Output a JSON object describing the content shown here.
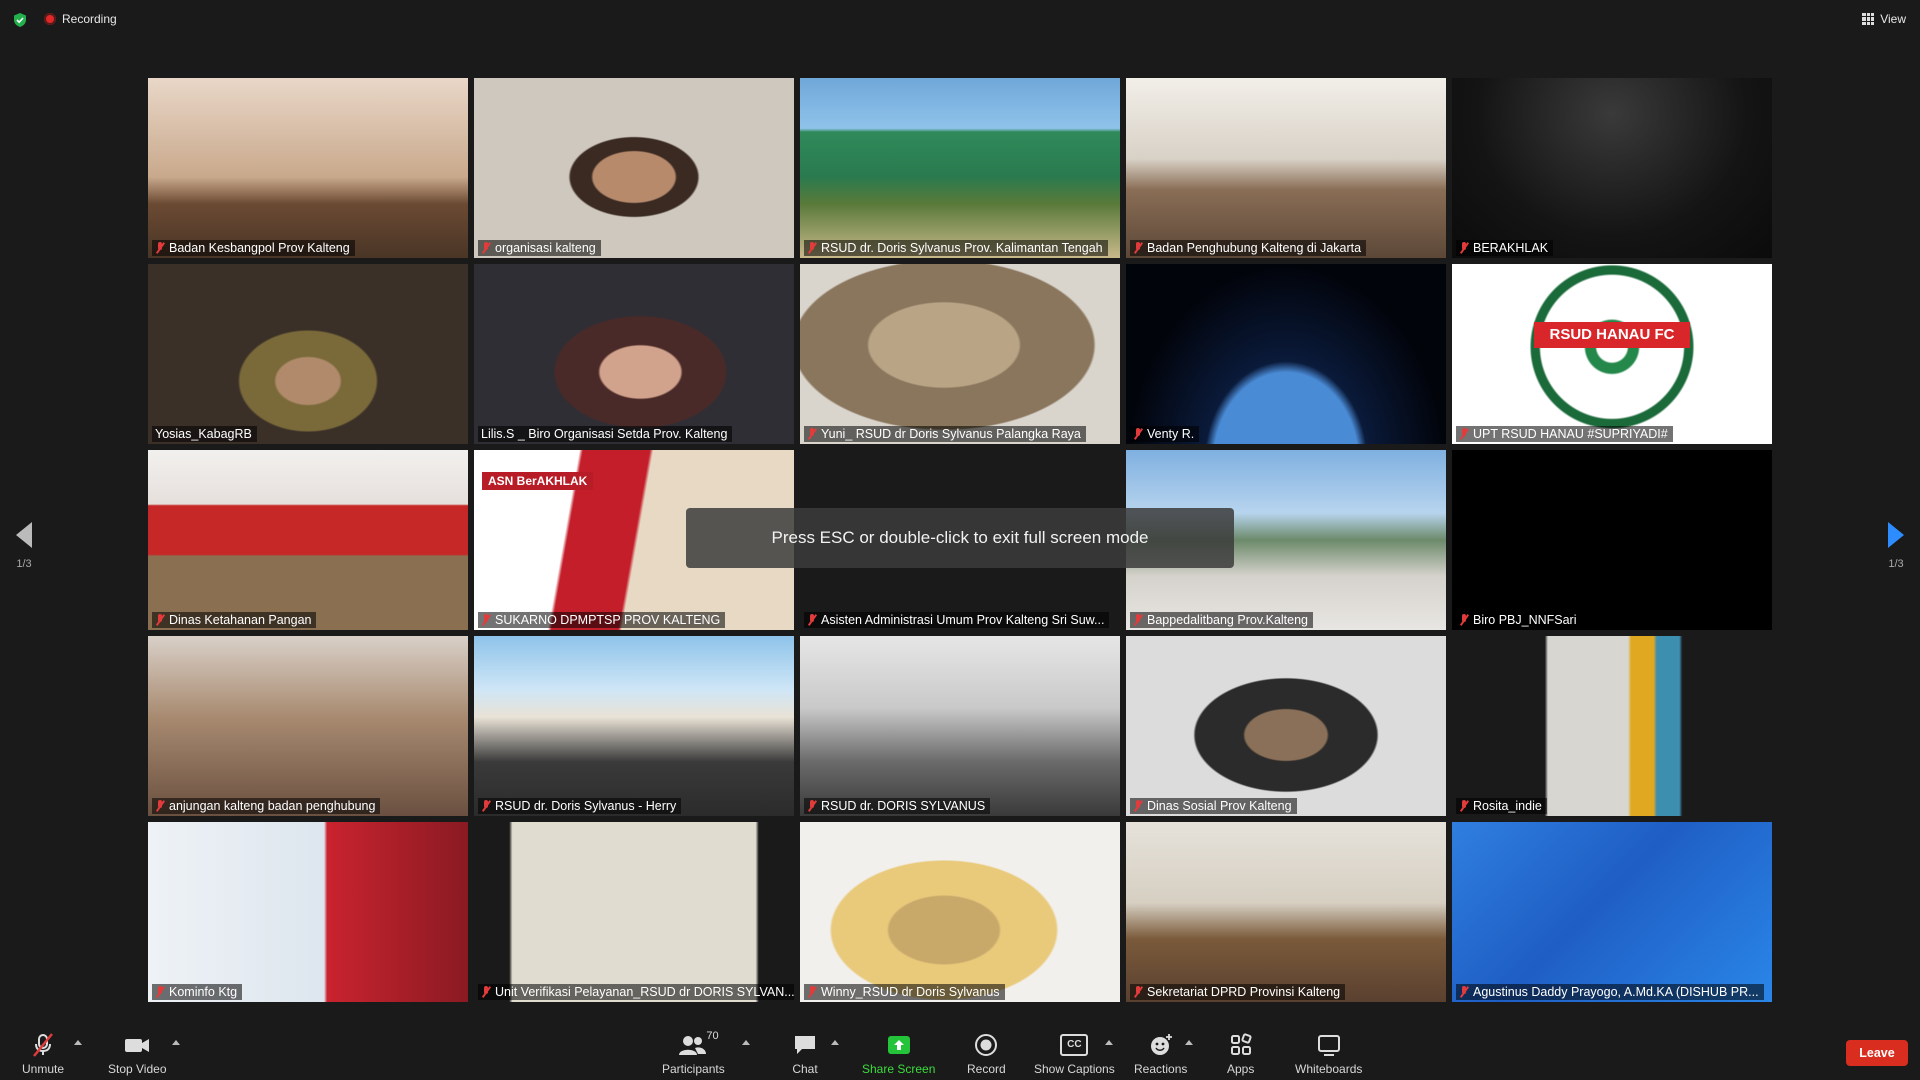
{
  "topbar": {
    "recording_label": "Recording",
    "view_label": "View"
  },
  "pager": {
    "left": "1/3",
    "right": "1/3"
  },
  "toast": "Press ESC or double-click to exit full screen mode",
  "tiles": [
    {
      "name": "Badan Kesbangpol Prov Kalteng",
      "muted": true,
      "scene": "meeting-room-curtain"
    },
    {
      "name": "organisasi kalteng",
      "muted": true,
      "scene": "person-closeup"
    },
    {
      "name": "RSUD dr. Doris Sylvanus Prov. Kalimantan Tengah",
      "muted": true,
      "scene": "hospital-sign"
    },
    {
      "name": "Badan Penghubung Kalteng di Jakarta",
      "muted": true,
      "scene": "official-room"
    },
    {
      "name": "BERAKHLAK",
      "muted": true,
      "scene": "dark"
    },
    {
      "name": "Yosias_KabagRB",
      "muted": false,
      "scene": "office-speaker",
      "active": true
    },
    {
      "name": "Lilis.S _ Biro Organisasi Setda Prov. Kalteng",
      "muted": false,
      "scene": "woman-glasses"
    },
    {
      "name": "Yuni_ RSUD dr Doris Sylvanus Palangka Raya",
      "muted": true,
      "scene": "hijab-closeup"
    },
    {
      "name": "Venty R.",
      "muted": true,
      "scene": "earth-space"
    },
    {
      "name": "UPT RSUD HANAU #SUPRIYADI#",
      "muted": true,
      "scene": "rsud-hanau-logo",
      "logo_text": "RSUD HANAU FC"
    },
    {
      "name": "Dinas Ketahanan Pangan",
      "muted": true,
      "scene": "red-banner-room"
    },
    {
      "name": "SUKARNO DPMPTSP PROV KALTENG",
      "muted": true,
      "scene": "asn-berakhlak",
      "banner_text": "ASN BerAKHLAK"
    },
    {
      "name": "Asisten Administrasi Umum Prov Kalteng Sri Suw...",
      "muted": true,
      "scene": "blank"
    },
    {
      "name": "Bappedalitbang Prov.Kalteng",
      "muted": true,
      "scene": "outdoor-building"
    },
    {
      "name": "Biro PBJ_NNFSari",
      "muted": true,
      "scene": "black"
    },
    {
      "name": "anjungan kalteng badan penghubung",
      "muted": true,
      "scene": "group-people"
    },
    {
      "name": "RSUD dr. Doris Sylvanus - Herry",
      "muted": true,
      "scene": "building-render"
    },
    {
      "name": "RSUD dr. DORIS SYLVANUS",
      "muted": true,
      "scene": "meeting-hall"
    },
    {
      "name": "Dinas Sosial Prov Kalteng",
      "muted": true,
      "scene": "hijab-glasses"
    },
    {
      "name": "Rosita_indie",
      "muted": true,
      "scene": "ceiling"
    },
    {
      "name": "Kominfo Ktg",
      "muted": true,
      "scene": "kominfo-room"
    },
    {
      "name": "Unit Verifikasi Pelayanan_RSUD dr DORIS SYLVAN...",
      "muted": true,
      "scene": "lobby-sofa"
    },
    {
      "name": "Winny_RSUD dr Doris Sylvanus",
      "muted": true,
      "scene": "hijab-yellow"
    },
    {
      "name": "Sekretariat DPRD Provinsi Kalteng",
      "muted": true,
      "scene": "dprd-room"
    },
    {
      "name": "Agustinus Daddy Prayogo, A.Md.KA (DISHUB PR...",
      "muted": true,
      "scene": "blue-presentation"
    }
  ],
  "toolbar": {
    "unmute": "Unmute",
    "stop_video": "Stop Video",
    "participants": "Participants",
    "participant_count": "70",
    "chat": "Chat",
    "share_screen": "Share Screen",
    "record": "Record",
    "show_captions": "Show Captions",
    "captions_icon_text": "CC",
    "reactions": "Reactions",
    "apps": "Apps",
    "whiteboards": "Whiteboards",
    "leave": "Leave"
  },
  "colors": {
    "active_speaker": "#d8d23e",
    "leave": "#d92d20",
    "share": "#3ddc3d",
    "accent": "#2d8cff"
  }
}
